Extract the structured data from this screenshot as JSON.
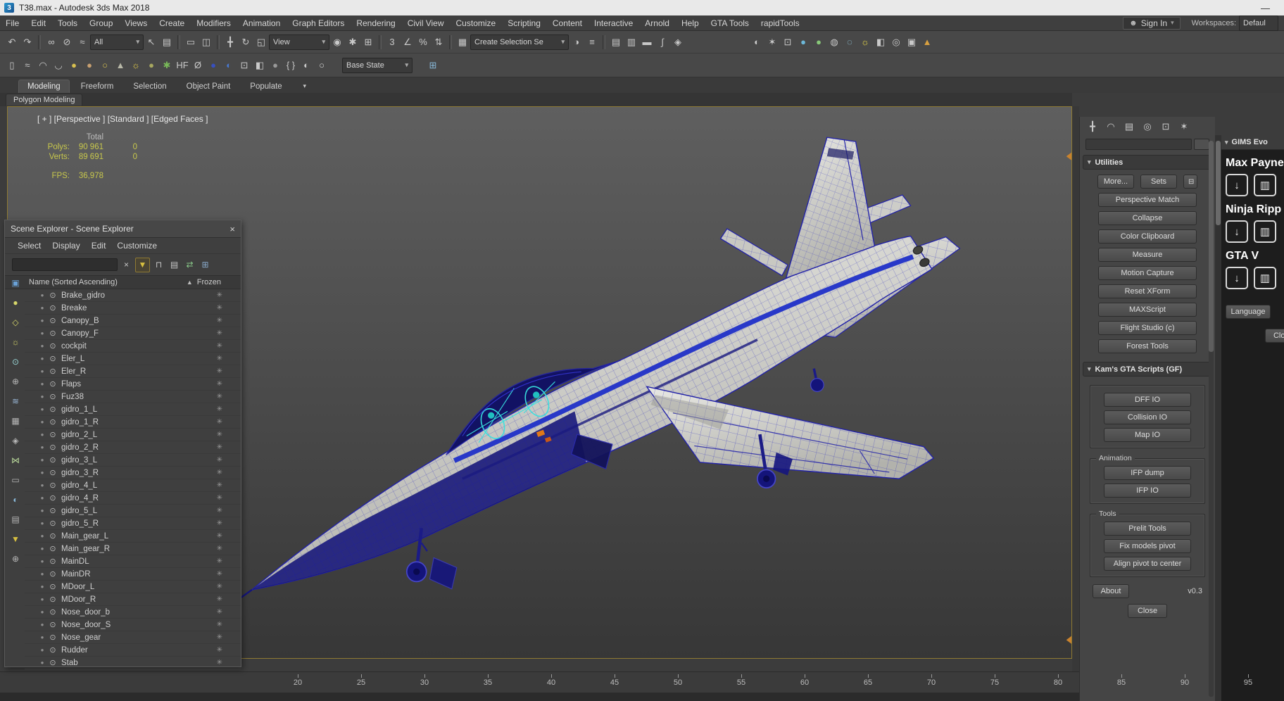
{
  "window": {
    "title": "T38.max - Autodesk 3ds Max 2018",
    "app_badge": "3",
    "minimize_glyph": "—"
  },
  "menubar": {
    "items": [
      "File",
      "Edit",
      "Tools",
      "Group",
      "Views",
      "Create",
      "Modifiers",
      "Animation",
      "Graph Editors",
      "Rendering",
      "Civil View",
      "Customize",
      "Scripting",
      "Content",
      "Interactive",
      "Arnold",
      "Help",
      "GTA Tools",
      "rapidTools"
    ],
    "sign_in_label": "Sign In",
    "user_glyph": "☻",
    "caret_glyph": "▾",
    "workspaces_label": "Workspaces:",
    "workspaces_value": "Defaul"
  },
  "toolbar1": {
    "filter_value": "All",
    "coord_value": "View",
    "sets_value": "Create Selection Se",
    "seg_a": [
      {
        "n": "undo-icon",
        "g": "↶"
      },
      {
        "n": "redo-icon",
        "g": "↷"
      }
    ],
    "seg_b": [
      {
        "n": "select-and-link-icon",
        "g": "∞"
      },
      {
        "n": "unlink-selection-icon",
        "g": "⊘"
      },
      {
        "n": "bind-to-space-warp-icon",
        "g": "≈"
      }
    ],
    "seg_c": [
      {
        "n": "select-object-icon",
        "g": "↖"
      },
      {
        "n": "select-by-name-icon",
        "g": "▤"
      }
    ],
    "seg_d": [
      {
        "n": "rectangular-selection-region-icon",
        "g": "▭"
      },
      {
        "n": "window-crossing-icon",
        "g": "◫"
      }
    ],
    "seg_e": [
      {
        "n": "select-and-move-icon",
        "g": "╋"
      },
      {
        "n": "select-and-rotate-icon",
        "g": "↻"
      },
      {
        "n": "select-and-scale-icon",
        "g": "◱"
      }
    ],
    "seg_f": [
      {
        "n": "use-pivot-point-icon",
        "g": "◉"
      },
      {
        "n": "select-and-manipulate-icon",
        "g": "✱"
      },
      {
        "n": "keyboard-override-icon",
        "g": "⊞"
      }
    ],
    "seg_g": [
      {
        "n": "snap-toggle-icon",
        "g": "3"
      },
      {
        "n": "angle-snap-icon",
        "g": "∠"
      },
      {
        "n": "percent-snap-icon",
        "g": "%"
      },
      {
        "n": "spinner-snap-icon",
        "g": "⇅"
      }
    ],
    "seg_h": [
      {
        "n": "edit-named-selection-sets-icon",
        "g": "▦"
      }
    ],
    "seg_i": [
      {
        "n": "mirror-icon",
        "g": "◑"
      },
      {
        "n": "align-icon",
        "g": "≡"
      }
    ],
    "seg_j": [
      {
        "n": "toggle-scene-explorer-icon",
        "g": "▤"
      },
      {
        "n": "toggle-layer-explorer-icon",
        "g": "▥"
      },
      {
        "n": "toggle-ribbon-icon",
        "g": "▬"
      },
      {
        "n": "curve-editor-icon",
        "g": "∫"
      },
      {
        "n": "schematic-view-icon",
        "g": "◈"
      }
    ],
    "seg_k": [
      {
        "n": "material-editor-icon",
        "g": "◐"
      },
      {
        "n": "render-setup-icon",
        "g": "✶"
      },
      {
        "n": "rendered-frame-window-icon",
        "g": "⊡"
      },
      {
        "n": "render-production-icon",
        "g": "●",
        "c": "#6db8d8"
      },
      {
        "n": "render-iterative-icon",
        "g": "●",
        "c": "#88c878"
      },
      {
        "n": "activeshade-icon",
        "g": "◍"
      },
      {
        "n": "render-in-cloud-icon",
        "g": "◌",
        "c": "#9ad8f0"
      },
      {
        "n": "daylight-icon",
        "g": "☼",
        "c": "#e8d848"
      },
      {
        "n": "exposure-control-icon",
        "g": "◧"
      },
      {
        "n": "environment-icon",
        "g": "◎"
      },
      {
        "n": "state-sets-icon",
        "g": "▣"
      },
      {
        "n": "isolate-selection-icon",
        "g": "▲",
        "c": "#d8a040"
      }
    ]
  },
  "toolbar2": {
    "base_state_value": "Base State",
    "icons": [
      {
        "n": "viewport-layout-icon",
        "g": "▯"
      },
      {
        "n": "paint-deform-icon",
        "g": "≈"
      },
      {
        "n": "conform-brush-icon",
        "g": "◠"
      },
      {
        "n": "relax-brush-icon",
        "g": "◡"
      },
      {
        "n": "standard-sphere-icon",
        "g": "●",
        "c": "#d8c050"
      },
      {
        "n": "clay-sphere-icon",
        "g": "●",
        "c": "#c8a070"
      },
      {
        "n": "torus-icon",
        "g": "○",
        "c": "#d8c050"
      },
      {
        "n": "cone-icon",
        "g": "▲",
        "c": "#b8b8a8"
      },
      {
        "n": "sun-icon",
        "g": "☼",
        "c": "#e8d048"
      },
      {
        "n": "geosphere-icon",
        "g": "●",
        "c": "#a8a860"
      },
      {
        "n": "foliage-icon",
        "g": "✱",
        "c": "#78b858"
      },
      {
        "n": "hf-badge-icon",
        "g": "HF"
      },
      {
        "n": "diameter-icon",
        "g": "Ø"
      },
      {
        "n": "navy-sphere-icon",
        "g": "●",
        "c": "#3850c0"
      },
      {
        "n": "half-sphere-icon",
        "g": "◐",
        "c": "#4878d0"
      },
      {
        "n": "camera-view-icon",
        "g": "⊡"
      },
      {
        "n": "shaded-toggle-icon",
        "g": "◧"
      },
      {
        "n": "gray-sphere-icon",
        "g": "●",
        "c": "#989898"
      },
      {
        "n": "script-braces-icon",
        "g": "{ }"
      },
      {
        "n": "material-ball-icon",
        "g": "◐"
      },
      {
        "n": "white-ball-icon",
        "g": "○",
        "c": "#d8d8d8"
      }
    ],
    "tail_icons": [
      {
        "n": "snapshot-states-icon",
        "g": "⊞",
        "c": "#88b8d8"
      }
    ]
  },
  "ribbon": {
    "tabs": [
      "Modeling",
      "Freeform",
      "Selection",
      "Object Paint",
      "Populate"
    ],
    "options_glyph": "▾",
    "subtab": "Polygon Modeling"
  },
  "viewport": {
    "label": "[ + ] [Perspective ] [Standard ] [Edged Faces ]",
    "stats": {
      "total_label": "Total",
      "polys_label": "Polys:",
      "polys_value": "90 961",
      "polys_col2": "0",
      "verts_label": "Verts:",
      "verts_value": "89 691",
      "verts_col2": "0",
      "fps_label": "FPS:",
      "fps_value": "36,978"
    }
  },
  "scene_explorer": {
    "title": "Scene Explorer - Scene Explorer",
    "close_glyph": "×",
    "menus": [
      "Select",
      "Display",
      "Edit",
      "Customize"
    ],
    "search_placeholder": "",
    "tool_icons": [
      {
        "n": "clear-search-icon",
        "g": "×"
      },
      {
        "n": "filter-funnel-icon",
        "g": "▼",
        "c": "#d8c040"
      },
      {
        "n": "lock-selection-icon",
        "g": "⊓"
      },
      {
        "n": "configure-columns-icon",
        "g": "▤"
      },
      {
        "n": "sync-selection-icon",
        "g": "⇄",
        "c": "#88c888"
      },
      {
        "n": "pick-parent-icon",
        "g": "⊞",
        "c": "#88a8c8"
      }
    ],
    "left_icons": [
      {
        "n": "sort-alphabetical-icon",
        "g": "▣",
        "c": "#6aa2d8"
      },
      {
        "n": "display-geometry-icon",
        "g": "●",
        "c": "#d8d86a"
      },
      {
        "n": "display-shapes-icon",
        "g": "◇",
        "c": "#d8d86a"
      },
      {
        "n": "display-lights-icon",
        "g": "☼",
        "c": "#d8d86a"
      },
      {
        "n": "display-cameras-icon",
        "g": "⊙",
        "c": "#9ad8d8"
      },
      {
        "n": "display-helpers-icon",
        "g": "⊕",
        "c": "#b8b8b8"
      },
      {
        "n": "display-spacewarps-icon",
        "g": "≋",
        "c": "#9ab8d8"
      },
      {
        "n": "display-groups-icon",
        "g": "▦",
        "c": "#b8b8b8"
      },
      {
        "n": "display-xrefs-icon",
        "g": "◈",
        "c": "#b8b8b8"
      },
      {
        "n": "display-bones-icon",
        "g": "⋈",
        "c": "#b8d89a"
      },
      {
        "n": "display-containers-icon",
        "g": "▭",
        "c": "#b8b8b8"
      },
      {
        "n": "display-materials-icon",
        "g": "◐",
        "c": "#88b8d8"
      },
      {
        "n": "display-selection-sets-icon",
        "g": "▤",
        "c": "#b8b8b8"
      },
      {
        "n": "filter-combination-icon",
        "g": "▼",
        "c": "#d8c040"
      },
      {
        "n": "pin-explorer-icon",
        "g": "⊕",
        "c": "#b8b8b8"
      }
    ],
    "name_column": "Name (Sorted Ascending)",
    "sort_glyph": "▲",
    "frozen_column": "Frozen",
    "row_icons": {
      "dot": "●",
      "eye": "⊙",
      "frozen": "✳"
    },
    "items": [
      "Brake_gidro",
      "Breake",
      "Canopy_B",
      "Canopy_F",
      "cockpit",
      "Eler_L",
      "Eler_R",
      "Flaps",
      "Fuz38",
      "gidro_1_L",
      "gidro_1_R",
      "gidro_2_L",
      "gidro_2_R",
      "gidro_3_L",
      "gidro_3_R",
      "gidro_4_L",
      "gidro_4_R",
      "gidro_5_L",
      "gidro_5_R",
      "Main_gear_L",
      "Main_gear_R",
      "MainDL",
      "MainDR",
      "MDoor_L",
      "MDoor_R",
      "Nose_door_b",
      "Nose_door_S",
      "Nose_gear",
      "Rudder",
      "Stab"
    ]
  },
  "command_panel": {
    "tabs": [
      {
        "n": "create-tab-icon",
        "g": "╋"
      },
      {
        "n": "modify-tab-icon",
        "g": "◠"
      },
      {
        "n": "hierarchy-tab-icon",
        "g": "▤"
      },
      {
        "n": "motion-tab-icon",
        "g": "◎"
      },
      {
        "n": "display-tab-icon",
        "g": "⊡"
      },
      {
        "n": "utilities-tab-icon",
        "g": "✶"
      }
    ],
    "utilities": {
      "header": "Utilities",
      "caret": "▾",
      "more_label": "More...",
      "sets_label": "Sets",
      "sets_icon_glyph": "⊟",
      "buttons": [
        "Perspective Match",
        "Collapse",
        "Color Clipboard",
        "Measure",
        "Motion Capture",
        "Reset XForm",
        "MAXScript",
        "Flight Studio (c)",
        "Forest Tools"
      ]
    },
    "kams": {
      "header": "Kam's GTA Scripts (GF)",
      "caret": "▾",
      "io_buttons": [
        "DFF IO",
        "Collision IO",
        "Map IO"
      ],
      "animation_label": "Animation",
      "animation_buttons": [
        "IFP dump",
        "IFP IO"
      ],
      "tools_label": "Tools",
      "tools_buttons": [
        "Prelit Tools",
        "Fix models pivot",
        "Align pivot to center"
      ],
      "about_label": "About",
      "version": "v0.3",
      "close_label": "Close"
    }
  },
  "gims": {
    "header": "GIMS Evo",
    "caret": "▾",
    "items": [
      {
        "label": "Max Payne"
      },
      {
        "label": "Ninja Ripp"
      },
      {
        "label": "GTA V"
      }
    ],
    "download_glyph": "↓",
    "trash_glyph": "▥",
    "language_label": "Language",
    "close_label": "Clos"
  },
  "timeline": {
    "ticks": [
      "20",
      "25",
      "30",
      "35",
      "40",
      "45",
      "50",
      "55",
      "60",
      "65",
      "70",
      "75",
      "80",
      "85",
      "90",
      "95"
    ]
  },
  "colors": {
    "wireframe_blue": "#2828c0",
    "cockpit_cyan": "#38e0e0",
    "viewport_border": "#8f7a33"
  }
}
